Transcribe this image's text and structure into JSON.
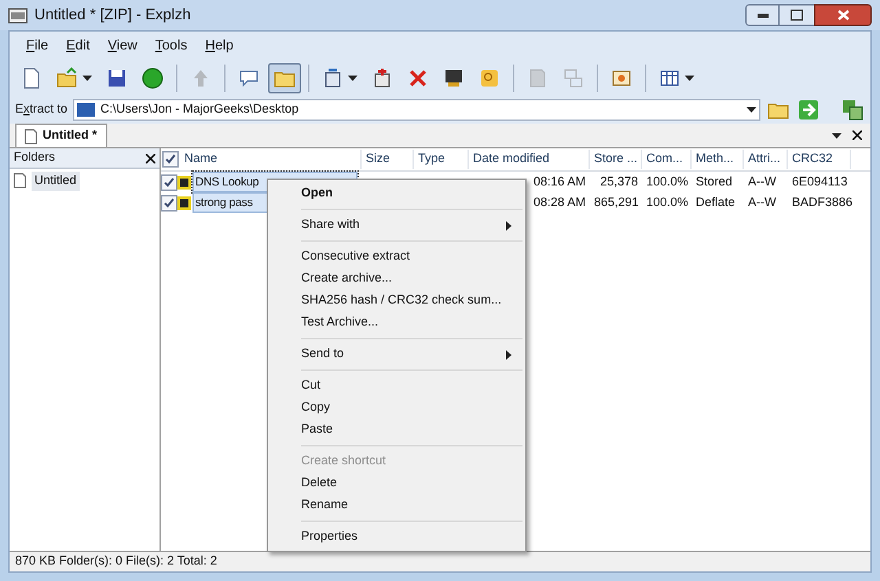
{
  "window": {
    "title": "Untitled * [ZIP] - Explzh"
  },
  "menu": [
    {
      "label": "File"
    },
    {
      "label": "Edit"
    },
    {
      "label": "View"
    },
    {
      "label": "Tools"
    },
    {
      "label": "Help"
    }
  ],
  "toolbar": [
    {
      "kind": "button",
      "selected": false,
      "dropdown": false
    },
    {
      "kind": "button",
      "selected": false,
      "dropdown": true
    },
    {
      "kind": "button",
      "selected": false,
      "dropdown": false
    },
    {
      "kind": "button",
      "selected": false,
      "dropdown": false
    },
    {
      "kind": "separator"
    },
    {
      "kind": "button",
      "selected": false,
      "dropdown": false,
      "disabled": true
    },
    {
      "kind": "separator"
    },
    {
      "kind": "button",
      "selected": false,
      "dropdown": false
    },
    {
      "kind": "button",
      "selected": true,
      "dropdown": false
    },
    {
      "kind": "separator"
    },
    {
      "kind": "button",
      "selected": false,
      "dropdown": true
    },
    {
      "kind": "button",
      "selected": false,
      "dropdown": false
    },
    {
      "kind": "button",
      "selected": false,
      "dropdown": false
    },
    {
      "kind": "button",
      "selected": false,
      "dropdown": false
    },
    {
      "kind": "button",
      "selected": false,
      "dropdown": false
    },
    {
      "kind": "separator"
    },
    {
      "kind": "button",
      "selected": false,
      "dropdown": false,
      "disabled": true
    },
    {
      "kind": "button",
      "selected": false,
      "dropdown": false,
      "disabled": true
    },
    {
      "kind": "separator"
    },
    {
      "kind": "button",
      "selected": false,
      "dropdown": false
    },
    {
      "kind": "separator"
    },
    {
      "kind": "button",
      "selected": false,
      "dropdown": true
    }
  ],
  "extract": {
    "label": "Extract to",
    "value": "C:\\Users\\Jon - MajorGeeks\\Desktop"
  },
  "tabs": [
    {
      "label": "Untitled *",
      "selected": true
    }
  ],
  "folders": {
    "title": "Folders",
    "items": [
      {
        "label": "Untitled",
        "selected": true
      }
    ]
  },
  "table": {
    "all_checked": true,
    "columns": [
      "Name",
      "Size",
      "Type",
      "Date modified",
      "Store ...",
      "Com...",
      "Meth...",
      "Attri...",
      "CRC32"
    ],
    "rows": [
      {
        "checked": true,
        "selected": true,
        "focused": true,
        "cells": [
          "DNS Lookup",
          null,
          null,
          "08:16 AM",
          "25,378",
          "100.0%",
          "Stored",
          "A--W",
          "6E094113"
        ]
      },
      {
        "checked": true,
        "selected": true,
        "focused": false,
        "cells": [
          "strong pass",
          null,
          null,
          "08:28 AM",
          "865,291",
          "100.0%",
          "Deflate",
          "A--W",
          "BADF3886"
        ]
      }
    ]
  },
  "context_menu": [
    {
      "kind": "item",
      "label": "Open",
      "bold": true,
      "disabled": false,
      "submenu": false
    },
    {
      "kind": "separator"
    },
    {
      "kind": "item",
      "label": "Share with",
      "bold": false,
      "disabled": false,
      "submenu": true
    },
    {
      "kind": "separator"
    },
    {
      "kind": "item",
      "label": "Consecutive extract",
      "bold": false,
      "disabled": false,
      "submenu": false
    },
    {
      "kind": "item",
      "label": "Create archive...",
      "bold": false,
      "disabled": false,
      "submenu": false
    },
    {
      "kind": "item",
      "label": "SHA256 hash / CRC32 check sum...",
      "bold": false,
      "disabled": false,
      "submenu": false
    },
    {
      "kind": "item",
      "label": "Test Archive...",
      "bold": false,
      "disabled": false,
      "submenu": false
    },
    {
      "kind": "separator"
    },
    {
      "kind": "item",
      "label": "Send to",
      "bold": false,
      "disabled": false,
      "submenu": true
    },
    {
      "kind": "separator"
    },
    {
      "kind": "item",
      "label": "Cut",
      "bold": false,
      "disabled": false,
      "submenu": false
    },
    {
      "kind": "item",
      "label": "Copy",
      "bold": false,
      "disabled": false,
      "submenu": false
    },
    {
      "kind": "item",
      "label": "Paste",
      "bold": false,
      "disabled": false,
      "submenu": false
    },
    {
      "kind": "separator"
    },
    {
      "kind": "item",
      "label": "Create shortcut",
      "bold": false,
      "disabled": true,
      "submenu": false
    },
    {
      "kind": "item",
      "label": "Delete",
      "bold": false,
      "disabled": false,
      "submenu": false
    },
    {
      "kind": "item",
      "label": "Rename",
      "bold": false,
      "disabled": false,
      "submenu": false
    },
    {
      "kind": "separator"
    },
    {
      "kind": "item",
      "label": "Properties",
      "bold": false,
      "disabled": false,
      "submenu": false
    }
  ],
  "status_bar": "870 KB  Folder(s): 0  File(s): 2  Total: 2"
}
